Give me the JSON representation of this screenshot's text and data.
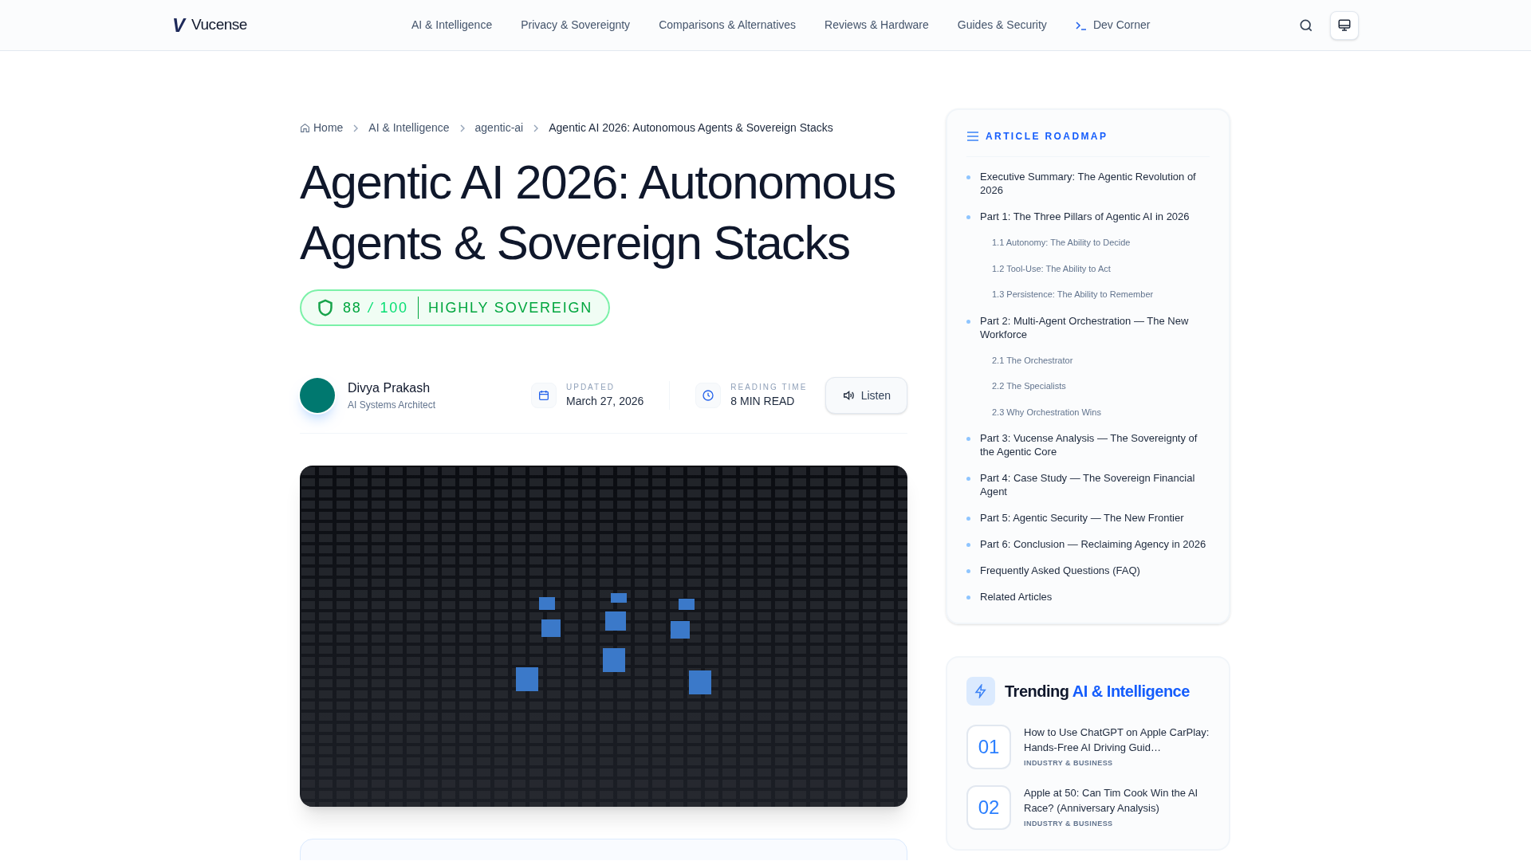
{
  "header": {
    "logo_mark": "V",
    "logo_text": "Vucense",
    "nav": [
      {
        "label": "AI & Intelligence",
        "kind": "link"
      },
      {
        "label": "Privacy & Sovereignty",
        "kind": "link"
      },
      {
        "label": "Comparisons & Alternatives",
        "kind": "link"
      },
      {
        "label": "Reviews & Hardware",
        "kind": "link"
      },
      {
        "label": "Guides & Security",
        "kind": "link"
      },
      {
        "label": "Dev Corner",
        "kind": "terminal"
      }
    ]
  },
  "breadcrumb": [
    {
      "label": "Home",
      "kind": "home"
    },
    {
      "label": "AI & Intelligence",
      "kind": "link"
    },
    {
      "label": "agentic-ai",
      "kind": "link"
    },
    {
      "label": "Agentic AI 2026: Autonomous Agents & Sovereign Stacks",
      "kind": "current"
    }
  ],
  "title": "Agentic AI 2026: Autonomous Agents & Sovereign Stacks",
  "score": {
    "value": "88",
    "separator": "/",
    "max": "100",
    "label": "HIGHLY SOVEREIGN"
  },
  "author": {
    "name": "Divya Prakash",
    "role": "AI Systems Architect"
  },
  "meta": [
    {
      "kind": "date",
      "label": "UPDATED",
      "value": "March 27, 2026"
    },
    {
      "kind": "time",
      "label": "READING TIME",
      "value": "8 MIN READ"
    }
  ],
  "listen_button": "Listen",
  "roadmap": {
    "heading": "ARTICLE ROADMAP",
    "items": [
      {
        "label": "Executive Summary: The Agentic Revolution of 2026"
      },
      {
        "label": "Part 1: The Three Pillars of Agentic AI in 2026",
        "children": [
          {
            "label": "1.1 Autonomy: The Ability to Decide"
          },
          {
            "label": "1.2 Tool-Use: The Ability to Act"
          },
          {
            "label": "1.3 Persistence: The Ability to Remember"
          }
        ]
      },
      {
        "label": "Part 2: Multi-Agent Orchestration — The New Workforce",
        "children": [
          {
            "label": "2.1 The Orchestrator"
          },
          {
            "label": "2.2 The Specialists"
          },
          {
            "label": "2.3 Why Orchestration Wins"
          }
        ]
      },
      {
        "label": "Part 3: Vucense Analysis — The Sovereignty of the Agentic Core"
      },
      {
        "label": "Part 4: Case Study — The Sovereign Financial Agent"
      },
      {
        "label": "Part 5: Agentic Security — The New Frontier"
      },
      {
        "label": "Part 6: Conclusion — Reclaiming Agency in 2026"
      },
      {
        "label": "Frequently Asked Questions (FAQ)"
      },
      {
        "label": "Related Articles"
      }
    ]
  },
  "trending": {
    "heading": "Trending",
    "topic": "AI & Intelligence",
    "items": [
      {
        "rank": "01",
        "title": "How to Use ChatGPT on Apple CarPlay: Hands-Free AI Driving Guid…",
        "category": "INDUSTRY & BUSINESS"
      },
      {
        "rank": "02",
        "title": "Apple at 50: Can Tim Cook Win the AI Race? (Anniversary Analysis)",
        "category": "INDUSTRY & BUSINESS"
      }
    ]
  }
}
